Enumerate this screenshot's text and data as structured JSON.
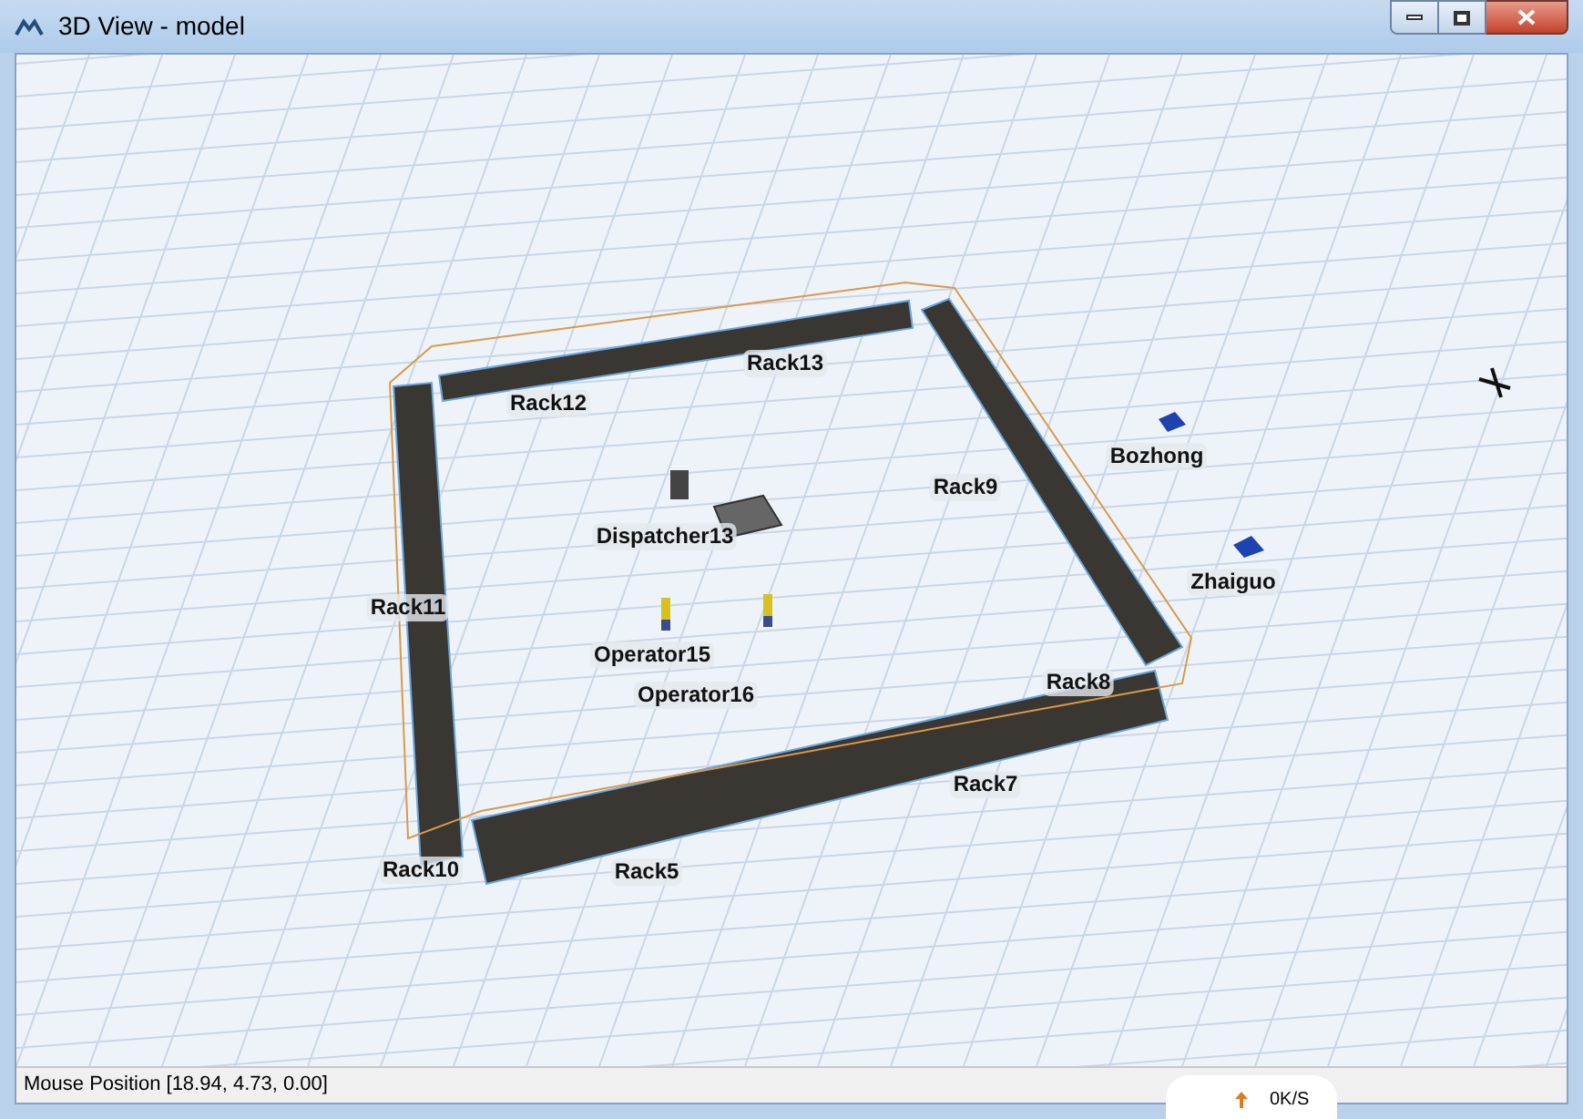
{
  "window": {
    "title": "3D View - model"
  },
  "viewport": {
    "labels": [
      {
        "text": "Rack13"
      },
      {
        "text": "Rack12"
      },
      {
        "text": "Bozhong"
      },
      {
        "text": "Rack9"
      },
      {
        "text": "Dispatcher13"
      },
      {
        "text": "Zhaiguo"
      },
      {
        "text": "Rack11"
      },
      {
        "text": "Operator15"
      },
      {
        "text": "Rack8"
      },
      {
        "text": "Operator16"
      },
      {
        "text": "Rack7"
      },
      {
        "text": "Rack10"
      },
      {
        "text": "Rack5"
      }
    ]
  },
  "status_bar": {
    "text": "Mouse Position [18.94, 4.73, 0.00]"
  },
  "network_widget": {
    "speed": "0K/S"
  }
}
